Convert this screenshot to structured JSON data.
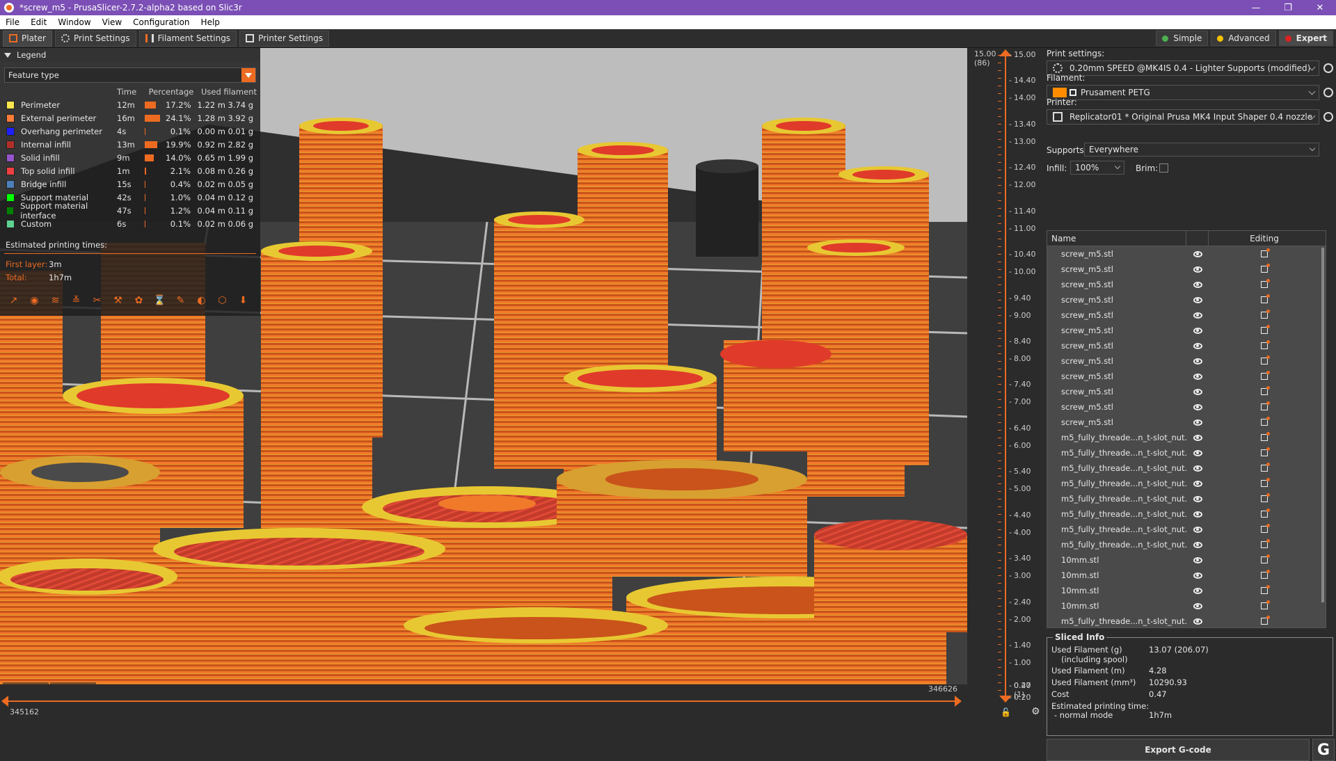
{
  "window": {
    "title": "*screw_m5 - PrusaSlicer-2.7.2-alpha2 based on Slic3r",
    "controls": [
      "—",
      "❐",
      "✕"
    ]
  },
  "menu": [
    "File",
    "Edit",
    "Window",
    "View",
    "Configuration",
    "Help"
  ],
  "tabs": [
    {
      "label": "Plater",
      "icon": "plater-icon"
    },
    {
      "label": "Print Settings",
      "icon": "print-settings-icon"
    },
    {
      "label": "Filament Settings",
      "icon": "filament-icon"
    },
    {
      "label": "Printer Settings",
      "icon": "printer-icon"
    }
  ],
  "modes": [
    {
      "label": "Simple",
      "color": "#4caf50"
    },
    {
      "label": "Advanced",
      "color": "#f5c400"
    },
    {
      "label": "Expert",
      "color": "#e02020"
    }
  ],
  "legend": {
    "title": "Legend",
    "view_type": "Feature type",
    "columns": [
      "Time",
      "Percentage",
      "Used filament"
    ],
    "rows": [
      {
        "name": "Perimeter",
        "color": "#ffe64d",
        "time": "12m",
        "pct": "17.2%",
        "pct_value": 17.2,
        "len": "1.22 m",
        "g": "3.74 g"
      },
      {
        "name": "External perimeter",
        "color": "#ff7d38",
        "time": "16m",
        "pct": "24.1%",
        "pct_value": 24.1,
        "len": "1.28 m",
        "g": "3.92 g"
      },
      {
        "name": "Overhang perimeter",
        "color": "#1f1fff",
        "time": "4s",
        "pct": "0.1%",
        "pct_value": 0.1,
        "len": "0.00 m",
        "g": "0.01 g"
      },
      {
        "name": "Internal infill",
        "color": "#b03029",
        "time": "13m",
        "pct": "19.9%",
        "pct_value": 19.9,
        "len": "0.92 m",
        "g": "2.82 g"
      },
      {
        "name": "Solid infill",
        "color": "#9654cc",
        "time": "9m",
        "pct": "14.0%",
        "pct_value": 14.0,
        "len": "0.65 m",
        "g": "1.99 g"
      },
      {
        "name": "Top solid infill",
        "color": "#f04040",
        "time": "1m",
        "pct": "2.1%",
        "pct_value": 2.1,
        "len": "0.08 m",
        "g": "0.26 g"
      },
      {
        "name": "Bridge infill",
        "color": "#4d80ba",
        "time": "15s",
        "pct": "0.4%",
        "pct_value": 0.4,
        "len": "0.02 m",
        "g": "0.05 g"
      },
      {
        "name": "Support material",
        "color": "#00ff00",
        "time": "42s",
        "pct": "1.0%",
        "pct_value": 1.0,
        "len": "0.04 m",
        "g": "0.12 g"
      },
      {
        "name": "Support material interface",
        "color": "#008000",
        "time": "47s",
        "pct": "1.2%",
        "pct_value": 1.2,
        "len": "0.04 m",
        "g": "0.11 g"
      },
      {
        "name": "Custom",
        "color": "#5ed194",
        "time": "6s",
        "pct": "0.1%",
        "pct_value": 0.1,
        "len": "0.02 m",
        "g": "0.06 g"
      }
    ],
    "estimated_title": "Estimated printing times:",
    "first_layer_label": "First layer:",
    "first_layer_value": "3m",
    "total_label": "Total:",
    "total_value": "1h7m"
  },
  "hslider": {
    "left": "345162",
    "right": "346626"
  },
  "vslider": {
    "top_value": "15.00",
    "top_layer": "(86)",
    "bottom_value": "0.20",
    "bottom_layer": "(1)",
    "ticks": [
      "15.00",
      "14.40",
      "14.00",
      "13.40",
      "13.00",
      "12.40",
      "12.00",
      "11.40",
      "11.00",
      "10.40",
      "10.00",
      "9.40",
      "9.00",
      "8.40",
      "8.00",
      "7.40",
      "7.00",
      "6.40",
      "6.00",
      "5.40",
      "5.00",
      "4.40",
      "4.00",
      "3.40",
      "3.00",
      "2.40",
      "2.00",
      "1.40",
      "1.00",
      "0.47",
      "0.20"
    ]
  },
  "right_panel": {
    "print_settings_label": "Print settings:",
    "print_settings_value": "0.20mm SPEED @MK4IS 0.4 - Lighter Supports (modified)",
    "filament_label": "Filament:",
    "filament_value": "Prusament PETG",
    "filament_color": "#ff8c00",
    "printer_label": "Printer:",
    "printer_value": "Replicator01 * Original Prusa MK4 Input Shaper 0.4 nozzle",
    "supports_label": "Supports:",
    "supports_value": "Everywhere",
    "infill_label": "Infill:",
    "infill_value": "100%",
    "brim_label": "Brim:",
    "list_header_name": "Name",
    "list_header_editing": "Editing",
    "objects": [
      "screw_m5.stl",
      "screw_m5.stl",
      "screw_m5.stl",
      "screw_m5.stl",
      "screw_m5.stl",
      "screw_m5.stl",
      "screw_m5.stl",
      "screw_m5.stl",
      "screw_m5.stl",
      "screw_m5.stl",
      "screw_m5.stl",
      "screw_m5.stl",
      "m5_fully_threade...n_t-slot_nut.stl",
      "m5_fully_threade...n_t-slot_nut.stl",
      "m5_fully_threade...n_t-slot_nut.stl",
      "m5_fully_threade...n_t-slot_nut.stl",
      "m5_fully_threade...n_t-slot_nut.stl",
      "m5_fully_threade...n_t-slot_nut.stl",
      "m5_fully_threade...n_t-slot_nut.stl",
      "m5_fully_threade...n_t-slot_nut.stl",
      "10mm.stl",
      "10mm.stl",
      "10mm.stl",
      "10mm.stl",
      "m5_fully_threade...n_t-slot_nut.stl"
    ],
    "sliced_title": "Sliced Info",
    "sliced": {
      "used_g_label": "Used Filament (g)",
      "used_g_sub": "(including spool)",
      "used_g_value": "13.07 (206.07)",
      "used_m_label": "Used Filament (m)",
      "used_m_value": "4.28",
      "used_mm3_label": "Used Filament (mm³)",
      "used_mm3_value": "10290.93",
      "cost_label": "Cost",
      "cost_value": "0.47",
      "est_label": "Estimated printing time:",
      "mode_label": "- normal mode",
      "mode_value": "1h7m"
    },
    "export_label": "Export G-code"
  }
}
